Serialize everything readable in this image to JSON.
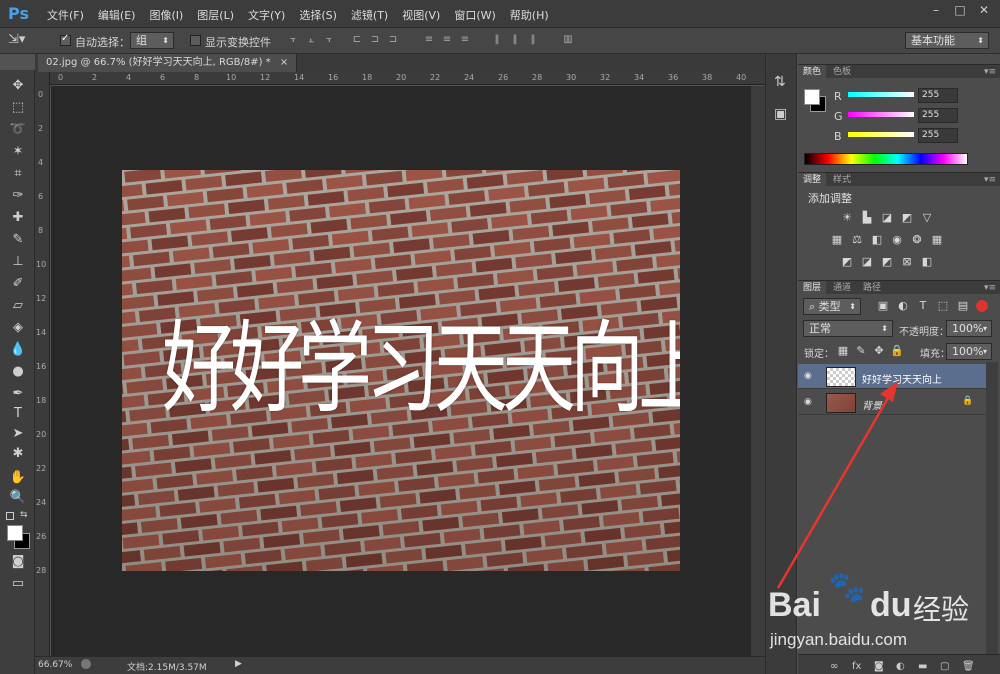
{
  "app": {
    "logo": "Ps",
    "menu": [
      "文件(F)",
      "编辑(E)",
      "图像(I)",
      "图层(L)",
      "文字(Y)",
      "选择(S)",
      "滤镜(T)",
      "视图(V)",
      "窗口(W)",
      "帮助(H)"
    ],
    "window_controls": [
      "–",
      "□",
      "✕"
    ]
  },
  "options": {
    "auto_select_label": "自动选择：",
    "auto_select_checked": true,
    "auto_select_value": "组",
    "show_transform_label": "显示变换控件",
    "show_transform_checked": false,
    "workspace": "基本功能"
  },
  "document": {
    "tab_title": "02.jpg @ 66.7% (好好学习天天向上, RGB/8#) *",
    "tab_close": "×",
    "canvas_text": "好好学习天天向上",
    "ruler_top": [
      "0",
      "2",
      "4",
      "6",
      "8",
      "10",
      "12",
      "14",
      "16",
      "18",
      "20",
      "22",
      "24",
      "26",
      "28",
      "30",
      "32",
      "34",
      "36",
      "38",
      "40"
    ],
    "ruler_left": [
      "0",
      "2",
      "4",
      "6",
      "8",
      "10",
      "12",
      "14",
      "16",
      "18",
      "20",
      "22",
      "24",
      "26",
      "28"
    ]
  },
  "status": {
    "zoom": "66.67%",
    "doc_info": "文档:2.15M/3.57M"
  },
  "color_panel": {
    "tabs": [
      "颜色",
      "色板"
    ],
    "channels": [
      {
        "label": "R",
        "value": "255"
      },
      {
        "label": "G",
        "value": "255"
      },
      {
        "label": "B",
        "value": "255"
      }
    ]
  },
  "adjust_panel": {
    "tabs": [
      "调整",
      "样式"
    ],
    "title": "添加调整"
  },
  "layers_panel": {
    "tabs": [
      "图层",
      "通道",
      "路径"
    ],
    "filter_label": "类型",
    "blend_mode": "正常",
    "opacity_label": "不透明度：",
    "opacity_value": "100%",
    "lock_label": "锁定：",
    "fill_label": "填充：",
    "fill_value": "100%",
    "layers": [
      {
        "name": "好好学习天天向上",
        "selected": true
      },
      {
        "name": "背景",
        "selected": false
      }
    ]
  },
  "watermark": {
    "brand": "Bai",
    "brand2": "du",
    "product": "经验",
    "url": "jingyan.baidu.com"
  },
  "colors": {
    "accent_arrow": "#e8352f",
    "selected_layer": "#5b6e8e",
    "ps_blue": "#4a9fe6"
  }
}
